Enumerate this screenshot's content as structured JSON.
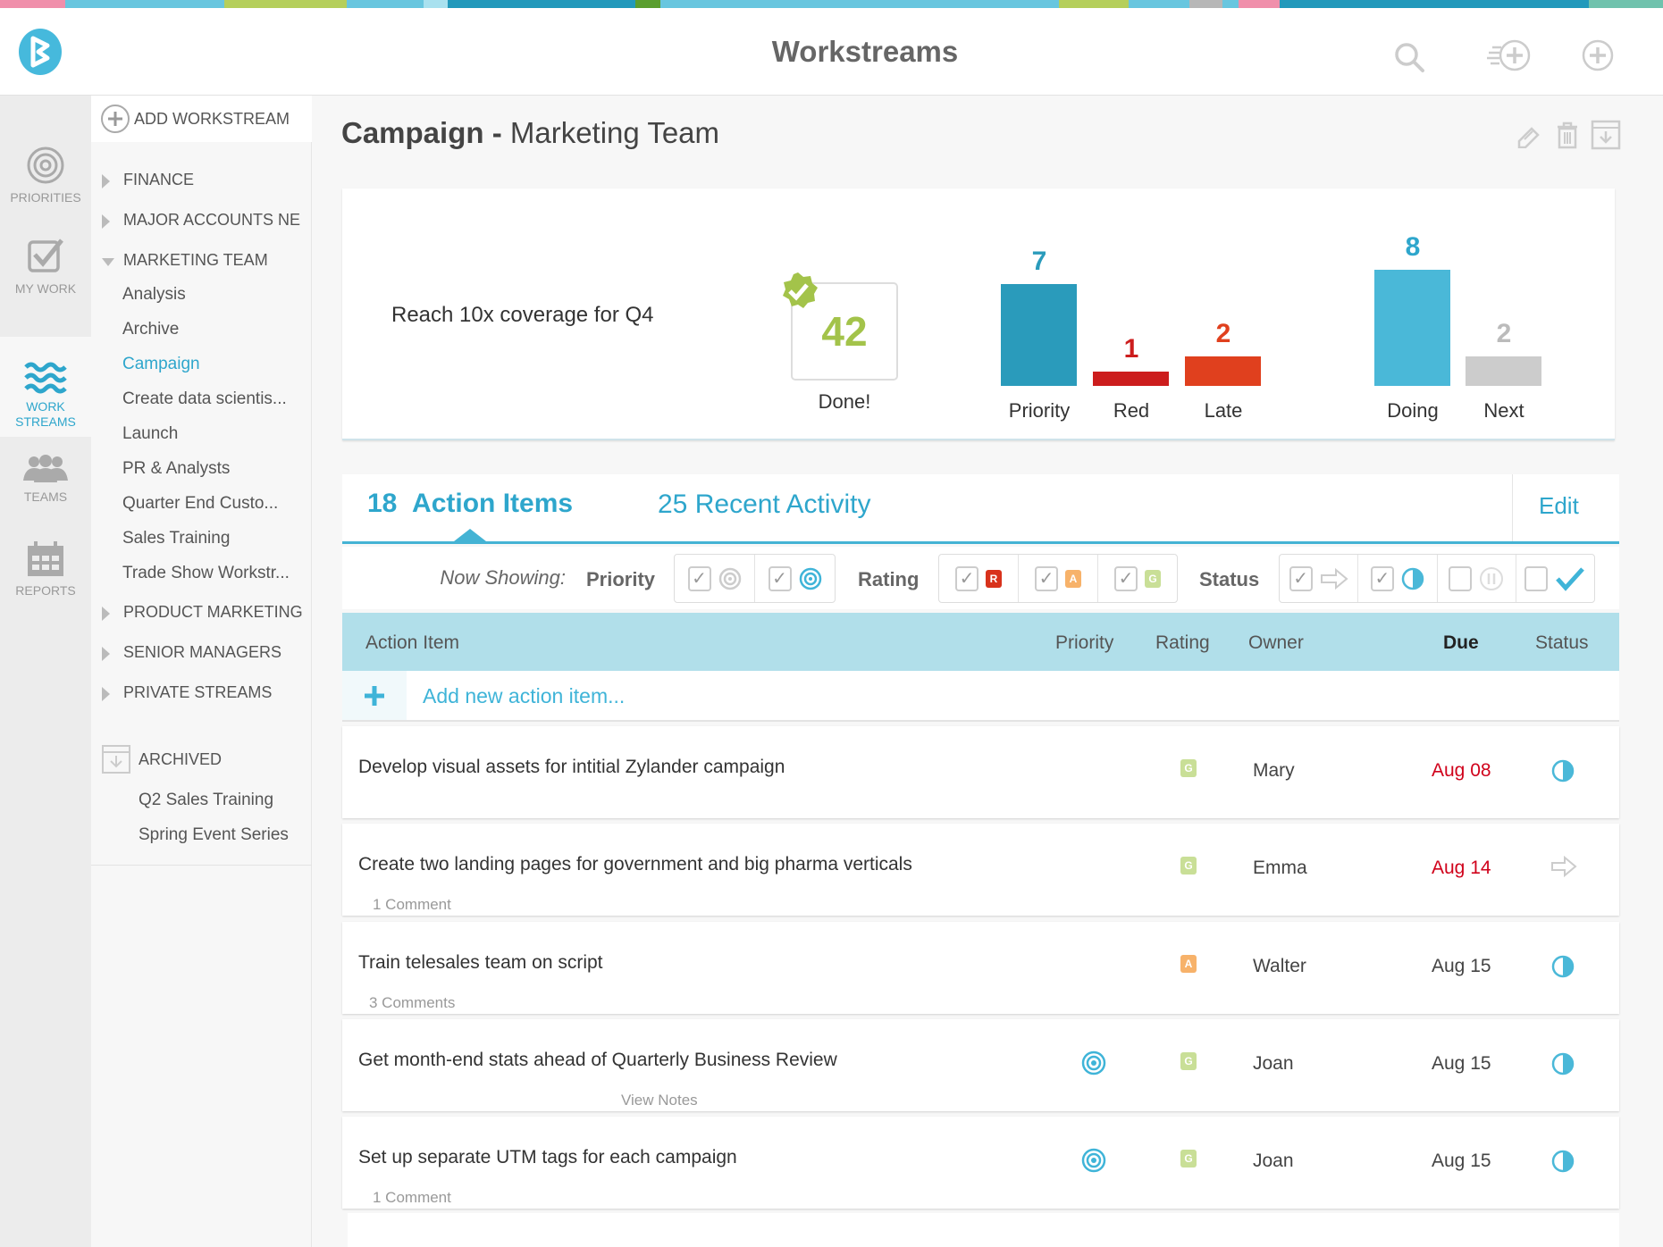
{
  "app": {
    "title": "Workstreams",
    "logo_letter": "B"
  },
  "colors": {
    "accent": "#2ea6cc",
    "green": "#a3c34a",
    "red": "#cc1d1d",
    "orange": "#e0401e",
    "late_due": "#d0021b",
    "header_row": "#b1dfea",
    "stripe": [
      "#f08fab",
      "#68c6df",
      "#b5cf5b",
      "#68c6df",
      "#a9e1ef",
      "#2299bb",
      "#5a9e2f",
      "#68c6df",
      "#b5cf5b",
      "#68c6df",
      "#b7b7b7",
      "#68c6df",
      "#f08fab",
      "#2299bb",
      "#70c2ad"
    ]
  },
  "header_icons": [
    "search-icon",
    "add-to-list-icon",
    "plus-circle-icon"
  ],
  "rail": [
    {
      "label": "PRIORITIES",
      "icon": "target-icon"
    },
    {
      "label": "MY WORK",
      "icon": "checkbox-icon"
    },
    {
      "label": "WORK\nSTREAMS",
      "icon": "waves-icon",
      "active": true
    },
    {
      "label": "TEAMS",
      "icon": "people-icon"
    },
    {
      "label": "REPORTS",
      "icon": "calendar-icon"
    }
  ],
  "sidebar": {
    "add_label": "ADD WORKSTREAM",
    "groups": [
      {
        "label": "FINANCE",
        "expanded": false
      },
      {
        "label": "MAJOR ACCOUNTS NE",
        "expanded": false
      },
      {
        "label": "MARKETING TEAM",
        "expanded": true,
        "items": [
          "Analysis",
          "Archive",
          "Campaign",
          "Create data scientis...",
          "Launch",
          "PR & Analysts",
          "Quarter End Custo...",
          "Sales Training",
          "Trade Show Workstr..."
        ],
        "active": "Campaign"
      },
      {
        "label": "PRODUCT MARKETING",
        "expanded": false
      },
      {
        "label": "SENIOR MANAGERS",
        "expanded": false
      },
      {
        "label": "PRIVATE STREAMS",
        "expanded": false
      }
    ],
    "archived_label": "ARCHIVED",
    "archived_items": [
      "Q2 Sales Training",
      "Spring Event Series"
    ]
  },
  "page": {
    "title_bold": "Campaign",
    "title_sep": " - ",
    "title_rest": "Marketing Team",
    "actions": [
      "edit-icon",
      "trash-icon",
      "archive-icon"
    ]
  },
  "summary": {
    "goal": "Reach 10x coverage for Q4",
    "done_count": "42",
    "done_label": "Done!",
    "bars": [
      {
        "label": "Priority",
        "value": 7,
        "color": "#2a9bbb",
        "num_color": "#2a9bbb"
      },
      {
        "label": "Red",
        "value": 1,
        "color": "#cc1d1d",
        "num_color": "#cc1d1d"
      },
      {
        "label": "Late",
        "value": 2,
        "color": "#e0401e",
        "num_color": "#e0401e"
      },
      {
        "label": "Doing",
        "value": 8,
        "color": "#4ab8d8",
        "num_color": "#2ea6cc"
      },
      {
        "label": "Next",
        "value": 2,
        "color": "#cccccc",
        "num_color": "#bbbbbb"
      }
    ]
  },
  "tabs": {
    "action_count": "18",
    "action_label": "Action Items",
    "activity_count": "25",
    "activity_label": "Recent Activity",
    "edit": "Edit"
  },
  "filters": {
    "now_showing": "Now Showing:",
    "priority": "Priority",
    "rating": "Rating",
    "status": "Status"
  },
  "table": {
    "headers": {
      "item": "Action Item",
      "priority": "Priority",
      "rating": "Rating",
      "owner": "Owner",
      "due": "Due",
      "status": "Status"
    },
    "add_placeholder": "Add new action item...",
    "rows": [
      {
        "title": "Develop visual assets for intitial Zylander campaign",
        "comment": "",
        "priority": false,
        "rating": "G",
        "owner": "Mary",
        "due": "Aug 08",
        "overdue": true,
        "status": "doing"
      },
      {
        "title": "Create two landing pages for government and big pharma verticals",
        "comment": "1 Comment",
        "priority": false,
        "rating": "G",
        "owner": "Emma",
        "due": "Aug 14",
        "overdue": true,
        "status": "next"
      },
      {
        "title": "Train telesales team on script",
        "comment": "3 Comments",
        "priority": false,
        "rating": "A",
        "owner": "Walter",
        "due": "Aug 15",
        "overdue": false,
        "status": "doing"
      },
      {
        "title": "Get month-end stats ahead of Quarterly Business Review",
        "comment": "View Notes",
        "priority": true,
        "rating": "G",
        "owner": "Joan",
        "due": "Aug 15",
        "overdue": false,
        "status": "doing"
      },
      {
        "title": "Set up separate UTM tags for each campaign",
        "comment": "1 Comment",
        "priority": true,
        "rating": "G",
        "owner": "Joan",
        "due": "Aug 15",
        "overdue": false,
        "status": "doing"
      }
    ]
  }
}
